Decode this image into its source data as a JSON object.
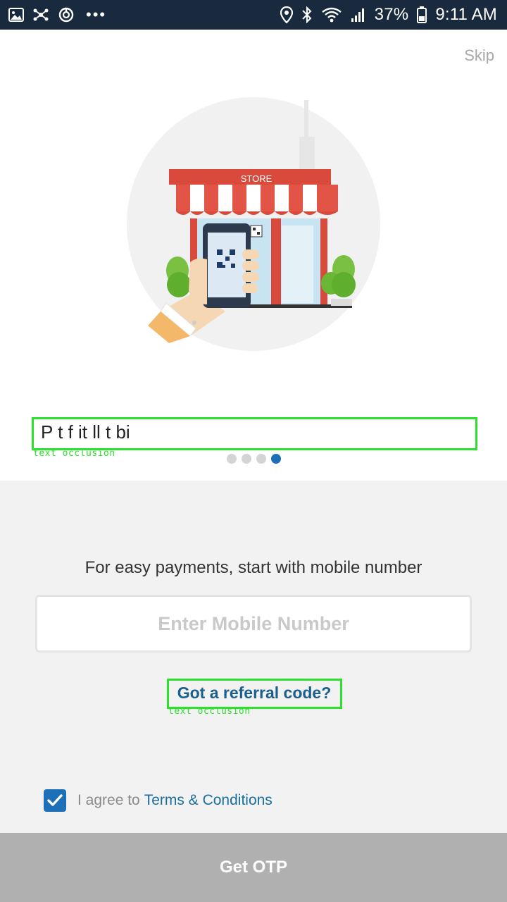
{
  "status_bar": {
    "battery": "37%",
    "time": "9:11 AM",
    "more_glyph": "•••",
    "left_icons": [
      "image-icon",
      "network-icon",
      "sync-icon"
    ],
    "right_icons": [
      "location-icon",
      "bluetooth-icon",
      "wifi-icon",
      "signal-icon",
      "battery-icon"
    ]
  },
  "onboarding": {
    "skip_label": "Skip",
    "caption_partial": "P    t     f      it     ll    t        bi",
    "caption_overlay_label": "text occlusion",
    "page_count": 4,
    "active_page": 4,
    "illustration": {
      "sign_text": "STORE",
      "description_icon": "store-qr-payment-illustration"
    }
  },
  "form": {
    "prompt": "For easy payments, start with mobile number",
    "mobile_placeholder": "Enter Mobile Number",
    "referral_label": "Got a referral code?",
    "referral_overlay_label": "text occlusion",
    "agree_prefix": "I agree to",
    "terms_label": "Terms & Conditions",
    "agree_checked": true
  },
  "cta": {
    "label": "Get OTP"
  },
  "colors": {
    "status_bar_bg": "#1a2a3e",
    "accent_blue": "#1d6fb8",
    "link_blue": "#1a6e9e",
    "button_disabled": "#b0b0b0",
    "form_bg": "#f2f2f2",
    "occlusion_green": "#2ee02e"
  }
}
